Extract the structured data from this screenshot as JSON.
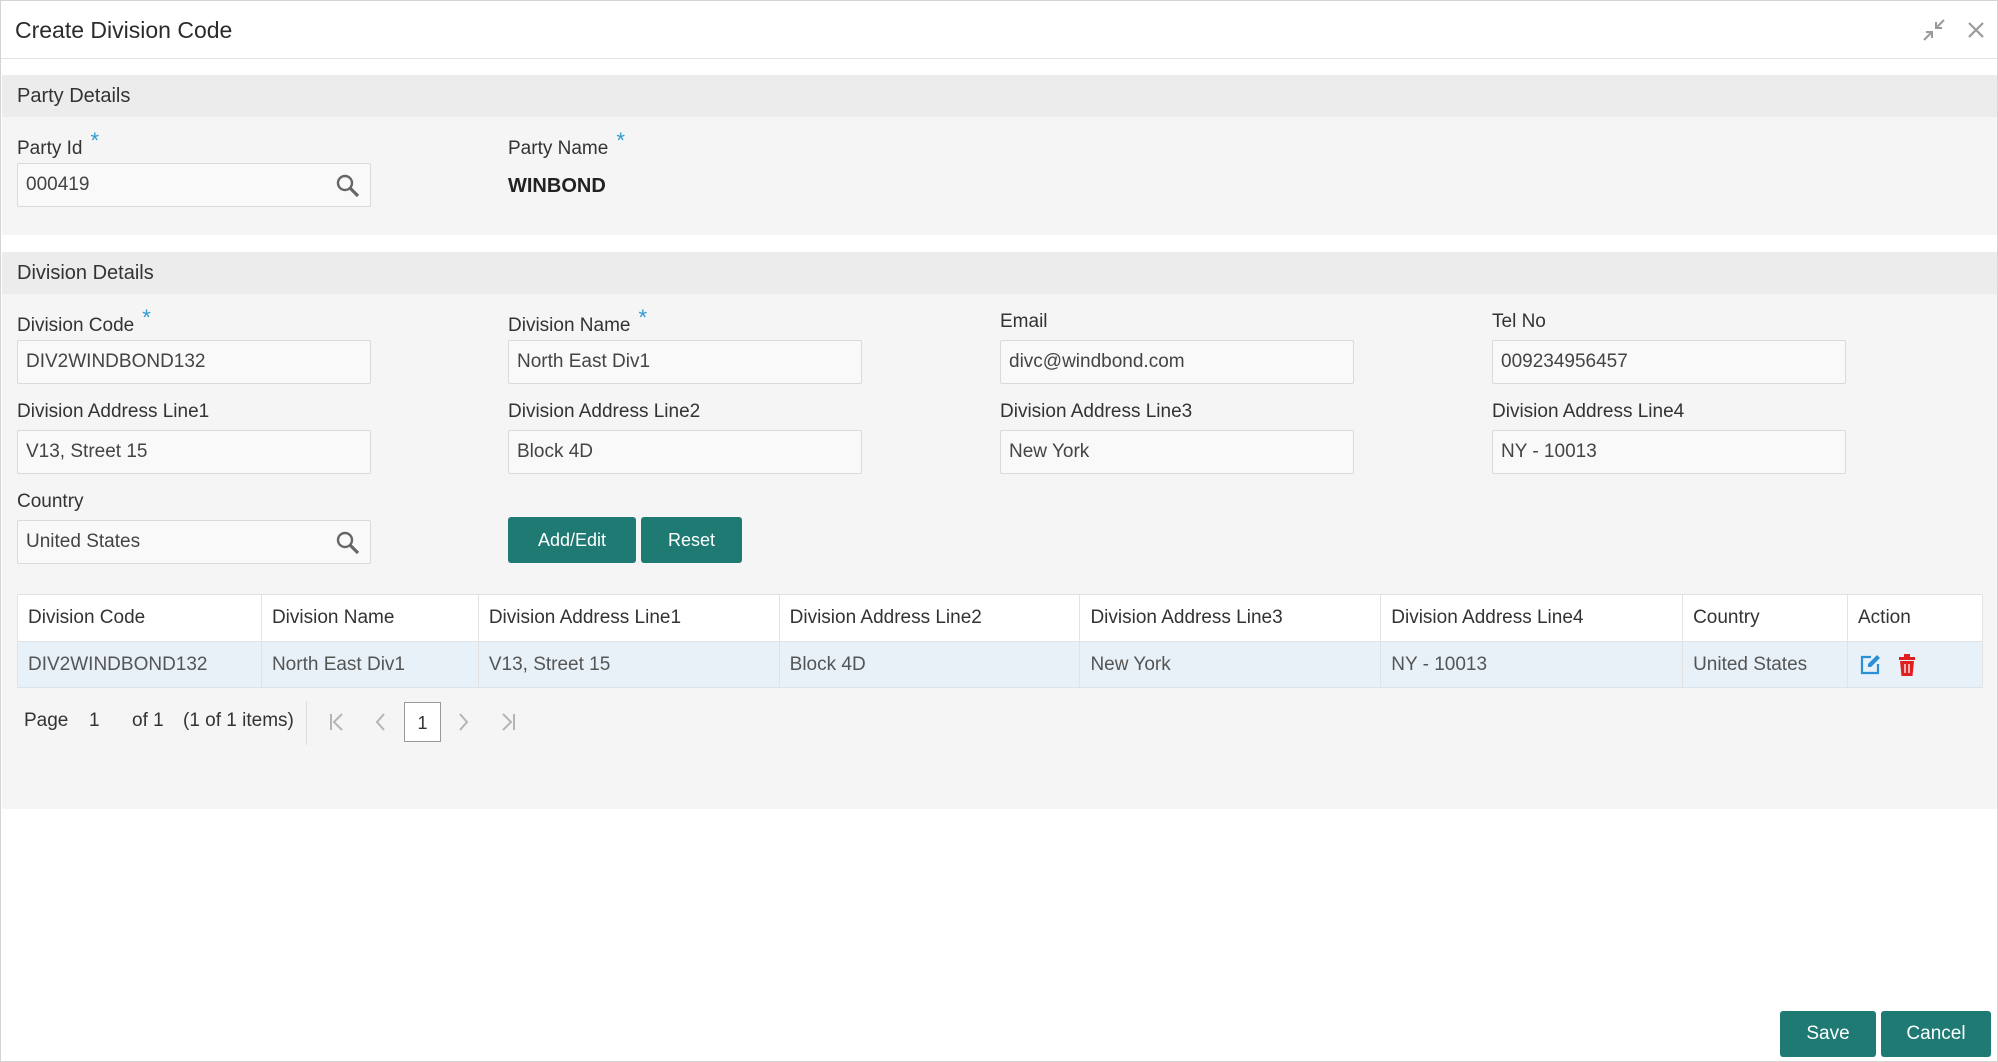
{
  "window": {
    "title": "Create Division Code",
    "minimize_icon": "collapse-arrows-icon",
    "close_icon": "close-icon"
  },
  "party_section": {
    "heading": "Party Details",
    "party_id": {
      "label": "Party Id",
      "required_mark": "*",
      "value": "000419"
    },
    "party_name": {
      "label": "Party Name",
      "required_mark": "*",
      "value": "WINBOND"
    }
  },
  "division_section": {
    "heading": "Division Details",
    "division_code": {
      "label": "Division Code",
      "required_mark": "*",
      "value": "DIV2WINDBOND132"
    },
    "division_name": {
      "label": "Division Name",
      "required_mark": "*",
      "value": "North East Div1"
    },
    "email": {
      "label": "Email",
      "value": "divc@windbond.com"
    },
    "tel_no": {
      "label": "Tel No",
      "value": "009234956457"
    },
    "address_line1": {
      "label": "Division Address Line1",
      "value": "V13, Street 15"
    },
    "address_line2": {
      "label": "Division Address Line2",
      "value": "Block 4D"
    },
    "address_line3": {
      "label": "Division Address Line3",
      "value": "New York"
    },
    "address_line4": {
      "label": "Division Address Line4",
      "value": "NY - 10013"
    },
    "country": {
      "label": "Country",
      "value": "United States"
    },
    "add_edit_label": "Add/Edit",
    "reset_label": "Reset"
  },
  "table": {
    "headers": [
      "Division Code",
      "Division Name",
      "Division Address Line1",
      "Division Address Line2",
      "Division Address Line3",
      "Division Address Line4",
      "Country",
      "Action"
    ],
    "rows": [
      [
        "DIV2WINDBOND132",
        "North East Div1",
        "V13, Street 15",
        "Block 4D",
        "New York",
        "NY - 10013",
        "United States"
      ]
    ],
    "action_icons": [
      "edit-icon",
      "delete-icon"
    ]
  },
  "pager": {
    "page_label": "Page",
    "page_number": "1",
    "of_label": "of 1",
    "items_label": "(1 of 1 items)",
    "current_page": "1"
  },
  "footer": {
    "save_label": "Save",
    "cancel_label": "Cancel"
  },
  "colors": {
    "accent": "#1e7a73",
    "required": "#2e9bd1",
    "edit_icon": "#2a8fd6",
    "delete_icon": "#e02020",
    "row_highlight": "#e8f1f8"
  }
}
